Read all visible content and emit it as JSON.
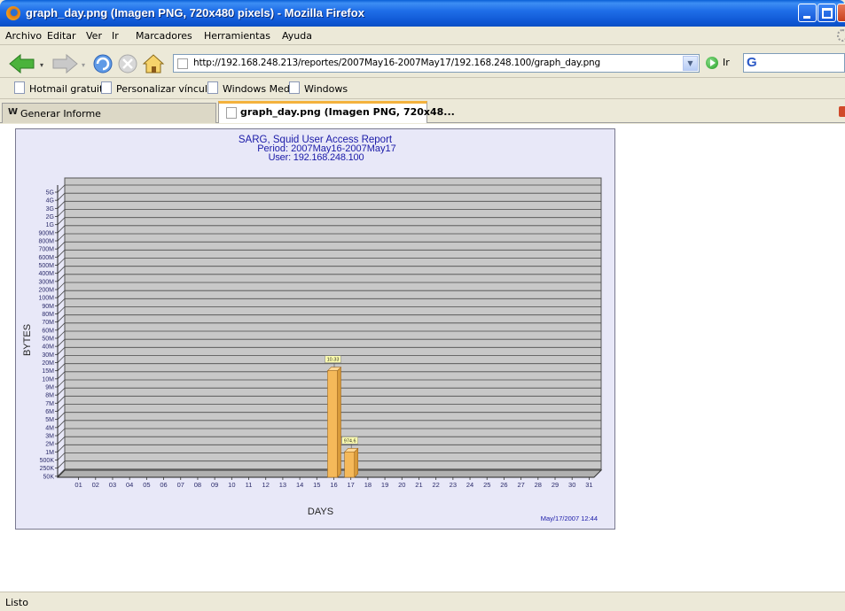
{
  "window": {
    "title": "graph_day.png (Imagen PNG, 720x480 pixels) - Mozilla Firefox"
  },
  "menu": [
    "Archivo",
    "Editar",
    "Ver",
    "Ir",
    "Marcadores",
    "Herramientas",
    "Ayuda"
  ],
  "navbar": {
    "url": "http://192.168.248.213/reportes/2007May16-2007May17/192.168.248.100/graph_day.png",
    "go_label": "Ir",
    "icons": [
      "back-arrow-icon",
      "forward-arrow-icon",
      "reload-icon",
      "stop-icon",
      "home-icon"
    ]
  },
  "bookmarks": [
    "Hotmail gratuito",
    "Personalizar vínculos",
    "Windows Media",
    "Windows"
  ],
  "tabs": [
    {
      "label": "Generar Informe",
      "active": false
    },
    {
      "label": "graph_day.png (Imagen PNG, 720x48...",
      "active": true
    }
  ],
  "status": "Listo",
  "chart_data": {
    "type": "bar",
    "title": "SARG, Squid User Access Report",
    "subtitle_period": "Period: 2007May16-2007May17",
    "subtitle_user": "User: 192.168.248.100",
    "xlabel": "DAYS",
    "ylabel": "BYTES",
    "y_scale": "custom-log",
    "y_ticks": [
      "50K",
      "250K",
      "500K",
      "1M",
      "2M",
      "3M",
      "4M",
      "5M",
      "6M",
      "7M",
      "8M",
      "9M",
      "10M",
      "15M",
      "20M",
      "30M",
      "40M",
      "50M",
      "60M",
      "70M",
      "80M",
      "90M",
      "100M",
      "200M",
      "300M",
      "400M",
      "500M",
      "600M",
      "700M",
      "800M",
      "900M",
      "1G",
      "2G",
      "3G",
      "4G",
      "5G"
    ],
    "categories": [
      "01",
      "02",
      "03",
      "04",
      "05",
      "06",
      "07",
      "08",
      "09",
      "10",
      "11",
      "12",
      "13",
      "14",
      "15",
      "16",
      "17",
      "18",
      "19",
      "20",
      "21",
      "22",
      "23",
      "24",
      "25",
      "26",
      "27",
      "28",
      "29",
      "30",
      "31"
    ],
    "bars": [
      {
        "day": "16",
        "label": "10.33",
        "value_tick": "15M"
      },
      {
        "day": "17",
        "label": "974.6",
        "value_tick": "1M"
      }
    ],
    "bar_color": "#f5b95a",
    "grid": true,
    "timestamp": "May/17/2007 12:44"
  }
}
